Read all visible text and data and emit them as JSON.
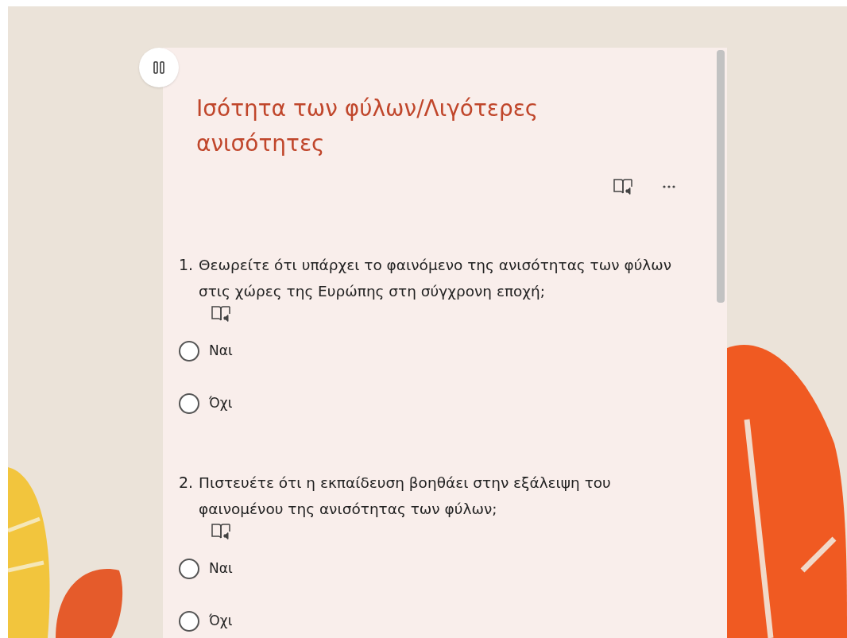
{
  "form": {
    "title": "Ισότητα των φύλων/Λιγότερες ανισότητες",
    "questions": [
      {
        "number": "1.",
        "text": "Θεωρείτε ότι υπάρχει το φαινόμενο της ανισότητας των φύλων στις χώρες της Ευρώπης στη σύγχρονη εποχή;",
        "options": [
          {
            "label": "Ναι",
            "selected": false
          },
          {
            "label": "Όχι",
            "selected": false
          }
        ]
      },
      {
        "number": "2.",
        "text": "Πιστευέτε ότι η εκπαίδευση βοηθάει στην εξάλειψη του φαινομένου της ανισότητας των φύλων;",
        "options": [
          {
            "label": "Ναι",
            "selected": false
          },
          {
            "label": "Όχι",
            "selected": false
          }
        ]
      }
    ]
  }
}
